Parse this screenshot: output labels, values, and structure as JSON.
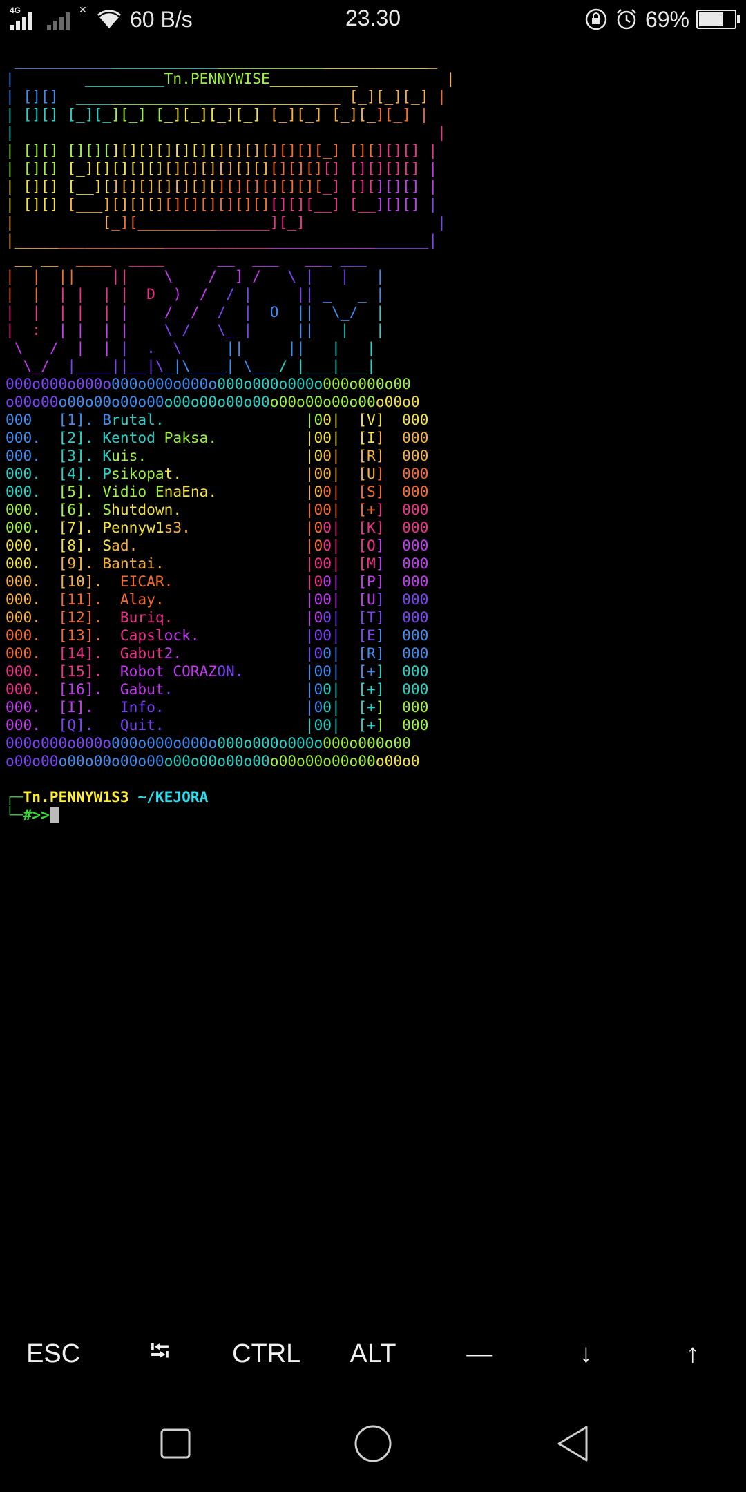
{
  "status_bar": {
    "network_type": "4G",
    "net_speed": "60 B/s",
    "time": "23.30",
    "battery": "69%",
    "battery_level": 0.69,
    "icons": [
      "signal-icon",
      "no-signal-icon",
      "wifi-icon",
      "rotation-lock-icon",
      "alarm-icon",
      "battery-icon"
    ]
  },
  "palette": [
    "#3d8cf2",
    "#22d3c8",
    "#9cf23a",
    "#f2e23a",
    "#f7b03a",
    "#f76a2a",
    "#f0308a",
    "#c33af2",
    "#7b42f7"
  ],
  "terminal": {
    "lines": [
      " ________________________________________________",
      "|        _________Tn.PENNYWISE__________          |",
      "| [][]  ______________________________ [_][_][_] |",
      "| [][] [_][_][_] [_][_][_][_] [_][_] [_][_][_] |",
      "|                                                |",
      "| [][] [][][][][][][][][][][][][][][_] [][][][] |",
      "| [][] [_][][][][][][][][][][][][][][] [][][][] |",
      "| [][] [__][][][][][][][][][][][][][_] [][][][] |",
      "| [][] [___][][][][][][][][][][][][__] [__][][] |",
      "|          [_][_______________][_]               |",
      "|_______________________________________________|",
      " __ __  ____  ____      __  ___   ___ ___",
      "|  |  ||    ||    \\    /  ] /   \\ |   |   |",
      "|  |  | |  | |  D  )  /  / |     || _   _ |",
      "|  |  | |  | |    /  /  /  |  O  ||  \\_/  |",
      "|  :  | |  | |    \\ /   \\_ |     ||   |   |",
      " \\   /  |  | |  .  \\     ||     ||   |   |",
      "  \\_/  |____||__|\\_|\\____| \\___/ |___|___|",
      "000o000o000o000o000o000o000o000o000o000o000o00",
      "o00o00o00o00o00o00o00o00o00o00o00o00o00o00o00o0",
      "000   [1]. Brutal.                |00|  [V]  000",
      "000.  [2]. Kentod Paksa.          |00|  [I]  000",
      "000.  [3]. Kuis.                  |00|  [R]  000",
      "000.  [4]. Psikopat.              |00|  [U]  000",
      "000.  [5]. Vidio EnaEna.          |00|  [S]  000",
      "000.  [6]. Shutdown.              |00|  [+]  000",
      "000.  [7]. Pennyw1s3.             |00|  [K]  000",
      "000.  [8]. Sad.                   |00|  [O]  000",
      "000.  [9]. Bantai.                |00|  [M]  000",
      "000.  [10].  EICAR.               |00|  [P]  000",
      "000.  [11].  Alay.                |00|  [U]  000",
      "000.  [12].  Buriq.               |00|  [T]  000",
      "000.  [13].  Capslock.            |00|  [E]  000",
      "000.  [14].  Gabut2.              |00|  [R]  000",
      "000.  [15].  Robot CORAZON.       |00|  [+]  000",
      "000.  [16].  Gabut.               |00|  [+]  000",
      "000.  [I].   Info.                |00|  [+]  000",
      "000.  [Q].   Quit.                |00|  [+]  000",
      "000o000o000o000o000o000o000o000o000o000o000o00",
      "o00o00o00o00o00o00o00o00o00o00o00o00o00o00o00o0",
      ""
    ],
    "prompt": {
      "corner_top": "┌─",
      "user": "Tn.PENNYW1S3",
      "dir": "~/KEJORA",
      "corner_bottom": "└─",
      "symbol": "#>>"
    }
  },
  "extra_keys": [
    "ESC",
    "⭾",
    "CTRL",
    "ALT",
    "—",
    "↓",
    "↑"
  ],
  "nav": [
    "recent-apps-button",
    "home-button",
    "back-button"
  ]
}
